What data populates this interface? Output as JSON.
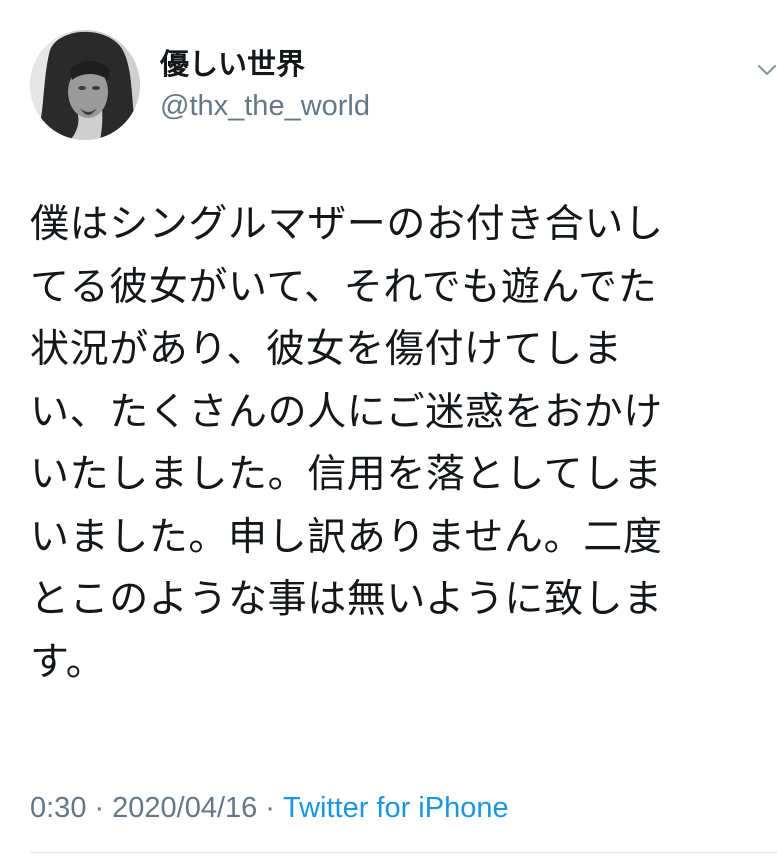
{
  "user": {
    "display_name": "優しい世界",
    "handle": "@thx_the_world",
    "avatar_icon": "profile-photo"
  },
  "tweet": {
    "lines": [
      "僕はシングルマザーのお付き合いし",
      "てる彼女がいて、それでも遊んでた",
      "状況があり、彼女を傷付けてしま",
      "い、たくさんの人にご迷惑をおかけ",
      "いたしました。信用を落としてしま",
      "いました。申し訳ありません。二度",
      "とこのような事は無いように致しま",
      "す。"
    ]
  },
  "meta": {
    "time": "0:30",
    "date": "2020/04/16",
    "separator": "·",
    "source": "Twitter for iPhone",
    "source_color": "#1b95e0"
  },
  "icons": {
    "caret": "chevron-down-icon"
  }
}
